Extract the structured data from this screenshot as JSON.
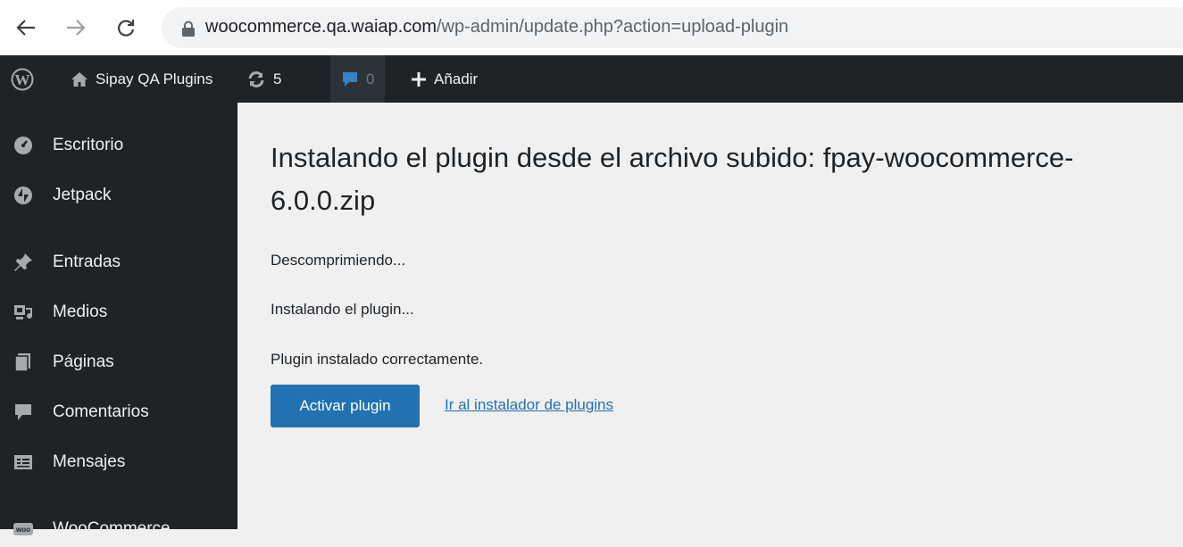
{
  "browser": {
    "url_host": "woocommerce.qa.waiap.com",
    "url_path": "/wp-admin/update.php?action=upload-plugin"
  },
  "adminbar": {
    "site_name": "Sipay QA Plugins",
    "updates_count": "5",
    "comments_count": "0",
    "new_label": "Añadir"
  },
  "sidebar": {
    "items": [
      {
        "label": "Escritorio",
        "icon": "dashboard-icon"
      },
      {
        "label": "Jetpack",
        "icon": "jetpack-icon"
      },
      {
        "label": "Entradas",
        "icon": "pin-icon"
      },
      {
        "label": "Medios",
        "icon": "media-icon"
      },
      {
        "label": "Páginas",
        "icon": "page-icon"
      },
      {
        "label": "Comentarios",
        "icon": "comment-icon"
      },
      {
        "label": "Mensajes",
        "icon": "messages-icon"
      },
      {
        "label": "WooCommerce",
        "icon": "woocommerce-icon"
      }
    ]
  },
  "main": {
    "title": "Instalando el plugin desde el archivo subido: fpay-woocommerce-6.0.0.zip",
    "messages": [
      "Descomprimiendo...",
      "Instalando el plugin...",
      "Plugin instalado correctamente."
    ],
    "activate_label": "Activar plugin",
    "installer_link_label": "Ir al instalador de plugins"
  },
  "colors": {
    "adminbar_bg": "#1d2327",
    "content_bg": "#f0f0f1",
    "primary_button": "#2271b1",
    "link": "#2271b1"
  }
}
